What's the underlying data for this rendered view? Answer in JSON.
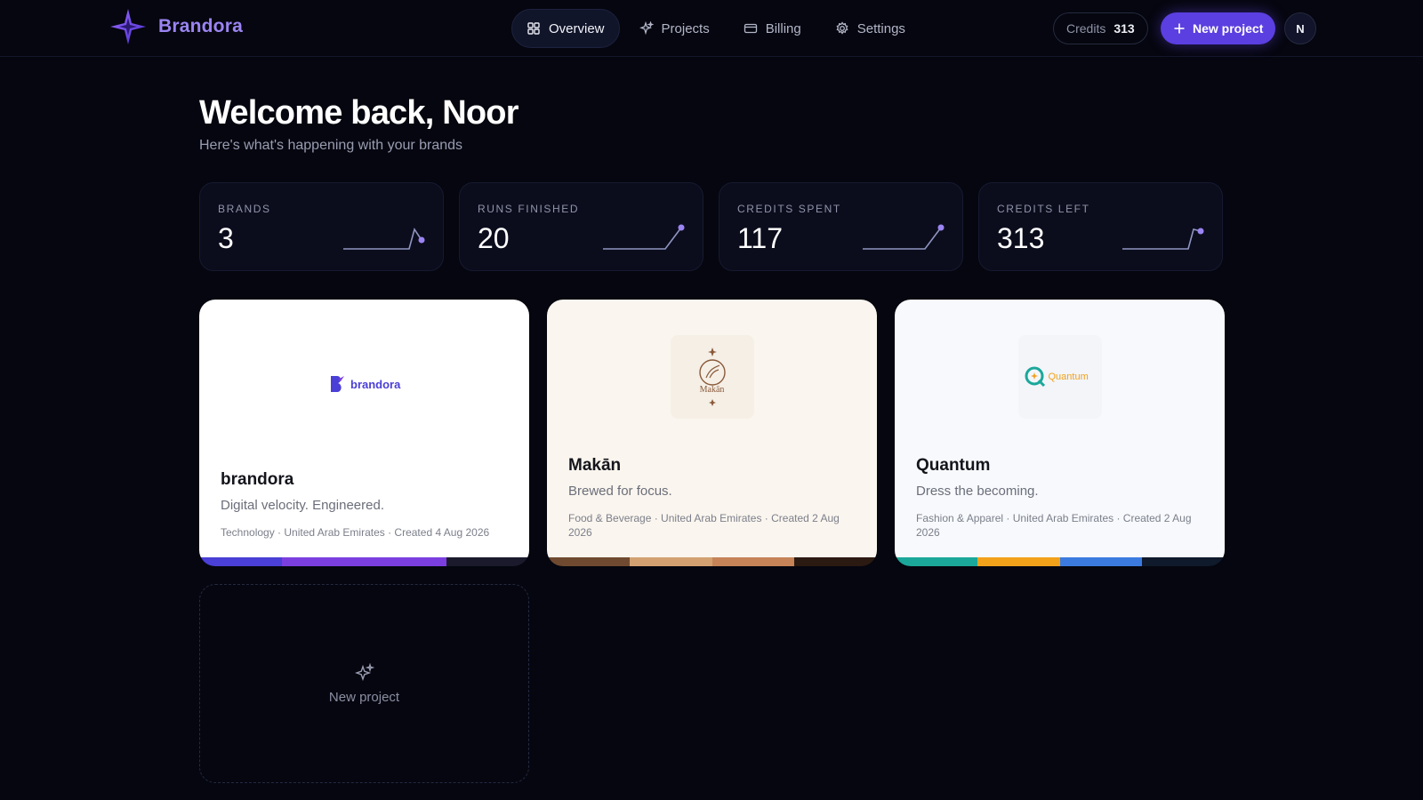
{
  "brand": {
    "name": "Brandora"
  },
  "nav": {
    "items": [
      {
        "label": "Overview",
        "icon": "grid-icon",
        "active": true
      },
      {
        "label": "Projects",
        "icon": "sparkle-icon",
        "active": false
      },
      {
        "label": "Billing",
        "icon": "card-icon",
        "active": false
      },
      {
        "label": "Settings",
        "icon": "gear-icon",
        "active": false
      }
    ]
  },
  "header": {
    "credits_label": "Credits",
    "credits_value": "313",
    "new_project_label": "New project",
    "avatar_initial": "N"
  },
  "welcome": {
    "title": "Welcome back, Noor",
    "subtitle": "Here's what's happening with your brands"
  },
  "stats": [
    {
      "label": "BRANDS",
      "value": "3"
    },
    {
      "label": "RUNS FINISHED",
      "value": "20"
    },
    {
      "label": "CREDITS SPENT",
      "value": "117"
    },
    {
      "label": "CREDITS LEFT",
      "value": "313"
    }
  ],
  "cards": [
    {
      "name": "brandora",
      "logo_text": "brandora",
      "tagline": "Digital velocity. Engineered.",
      "meta": "Technology · United Arab Emirates · Created 4 Aug 2026",
      "bg": "#ffffff",
      "palette": [
        "#4a3fd6",
        "#7b3fe0",
        "#7b3fe0",
        "#1a1a2c"
      ]
    },
    {
      "name": "Makān",
      "logo_text": "Makān",
      "tagline": "Brewed for focus.",
      "meta": "Food & Beverage · United Arab Emirates · Created 2 Aug 2026",
      "bg": "#faf5ee",
      "palette": [
        "#6f4a30",
        "#d2a071",
        "#c58357",
        "#2b1a12"
      ]
    },
    {
      "name": "Quantum",
      "logo_text": "Quantum",
      "tagline": "Dress the becoming.",
      "meta": "Fashion & Apparel · United Arab Emirates · Created 2 Aug 2026",
      "bg": "#f7f9fc",
      "palette": [
        "#1ba89a",
        "#f2a11a",
        "#3b7be0",
        "#0f1a2c"
      ]
    }
  ],
  "new_card": {
    "label": "New project"
  },
  "colors": {
    "accent": "#5b3fe0",
    "background": "#05060f"
  }
}
